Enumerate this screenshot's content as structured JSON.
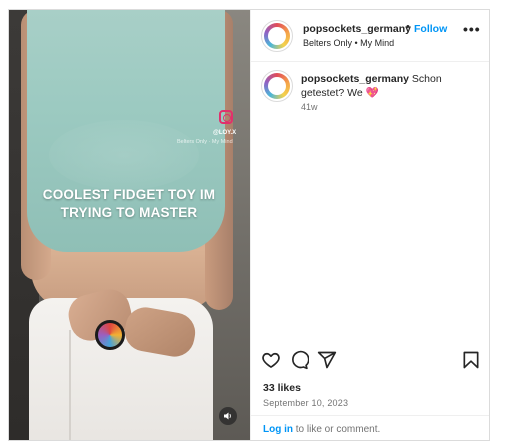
{
  "media": {
    "caption_line1": "COOLEST FIDGET TOY IM",
    "caption_line2": "TRYING TO MASTER",
    "overlay_handle": "@LOY.X",
    "overlay_audio": "Belters Only · My Mind",
    "sound_icon": "speaker-icon"
  },
  "header": {
    "username": "popsockets_germany",
    "dot": "•",
    "follow_label": "Follow",
    "audio": "Belters Only • My Mind",
    "more_label": "•••"
  },
  "post": {
    "username": "popsockets_germany",
    "text": "Schon getestet? We",
    "emoji": "💖",
    "time": "41w"
  },
  "actions": {
    "icons": [
      "heart-icon",
      "comment-icon",
      "share-icon",
      "bookmark-icon"
    ],
    "likes": "33 likes",
    "date": "September 10, 2023"
  },
  "footer": {
    "login_label": "Log in",
    "rest": " to like or comment."
  },
  "colors": {
    "accent": "#0095f6",
    "heart": "#e8449c",
    "crop_top": "#9ccac1"
  }
}
